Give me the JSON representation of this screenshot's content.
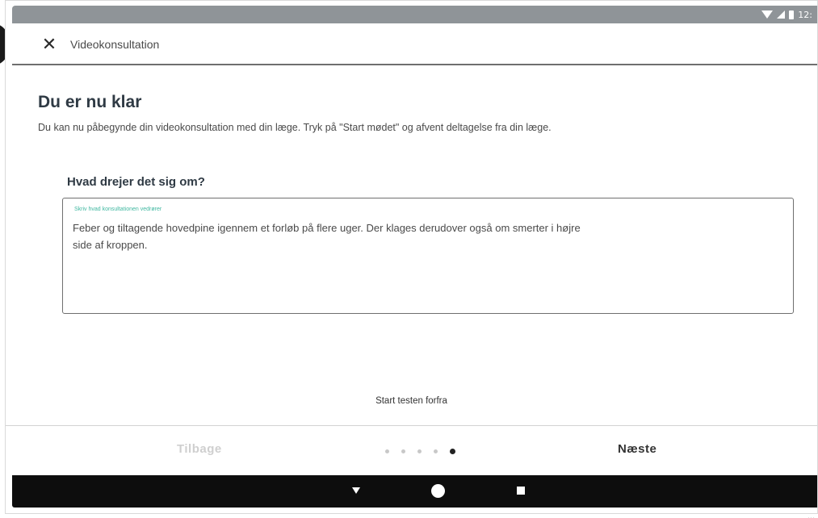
{
  "status_bar": {
    "icons": [
      "wifi-icon",
      "signal-icon",
      "battery-icon"
    ],
    "time": "12:"
  },
  "app_bar": {
    "close_icon": "✕",
    "title": "Videokonsultation"
  },
  "main": {
    "heading": "Du er nu klar",
    "intro": "Du kan nu påbegynde din videokonsultation med din læge. Tryk på \"Start mødet\" og afvent deltagelse fra din læge.",
    "question": "Hvad drejer det sig om?",
    "field": {
      "label": "Skriv hvad konsultationen vedrører",
      "value": "Feber og tiltagende hovedpine igennem et forløb på flere uger. Der klages derudover også om smerter i højre side af kroppen."
    },
    "restart_link": "Start testen forfra"
  },
  "navigation": {
    "back_label": "Tilbage",
    "next_label": "Næste",
    "pager": {
      "total": 5,
      "current": 5
    }
  },
  "corner_text": "...",
  "colors": {
    "accent": "#3fb7a0",
    "heading": "#2f3a44",
    "status_bar": "#8f9498",
    "system_nav": "#0d0d0d"
  }
}
